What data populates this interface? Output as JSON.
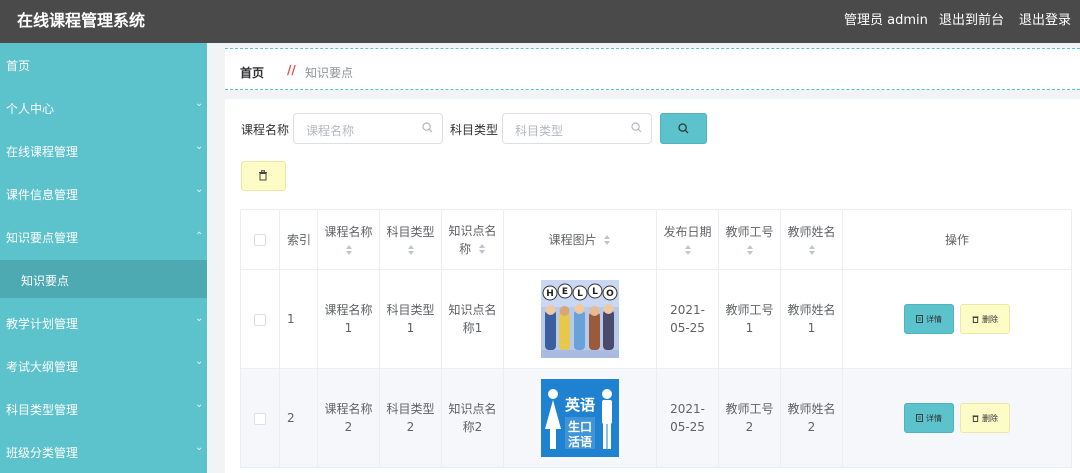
{
  "header": {
    "title": "在线课程管理系统",
    "admin": "管理员 admin",
    "to_front": "退出到前台",
    "logout": "退出登录"
  },
  "sidebar": {
    "items": [
      {
        "label": "首页"
      },
      {
        "label": "个人中心"
      },
      {
        "label": "在线课程管理"
      },
      {
        "label": "课件信息管理"
      },
      {
        "label": "知识要点管理"
      },
      {
        "label": "知识要点"
      },
      {
        "label": "教学计划管理"
      },
      {
        "label": "考试大纲管理"
      },
      {
        "label": "科目类型管理"
      },
      {
        "label": "班级分类管理"
      }
    ]
  },
  "breadcrumb": {
    "home": "首页",
    "separator": "//",
    "current": "知识要点"
  },
  "search": {
    "course_label": "课程名称",
    "course_placeholder": "课程名称",
    "subject_label": "科目类型",
    "subject_placeholder": "科目类型"
  },
  "table": {
    "headers": {
      "index": "索引",
      "course_name": "课程名称",
      "subject_type": "科目类型",
      "point_name": "知识点名称",
      "course_image": "课程图片",
      "publish_date": "发布日期",
      "teacher_no": "教师工号",
      "teacher_name": "教师姓名",
      "actions": "操作"
    },
    "rows": [
      {
        "index": "1",
        "course_name": "课程名称1",
        "subject_type": "科目类型1",
        "point_name": "知识点名称1",
        "image_text": "HELLO",
        "publish_date": "2021-05-25",
        "teacher_no": "教师工号1",
        "teacher_name": "教师姓名1"
      },
      {
        "index": "2",
        "course_name": "课程名称2",
        "subject_type": "科目类型2",
        "point_name": "知识点名称2",
        "image_text": "英语 生口 活语",
        "publish_date": "2021-05-25",
        "teacher_no": "教师工号2",
        "teacher_name": "教师姓名2"
      }
    ],
    "detail_label": "详情",
    "delete_label": "删除"
  },
  "colors": {
    "topbar": "#4a4a4a",
    "sidebar": "#5cc2cc",
    "sidebar_active": "#4da9b2",
    "accent": "#5cc2cc",
    "danger_bg": "#fdfbc6",
    "breadcrumb_sep": "#e84a4a"
  }
}
